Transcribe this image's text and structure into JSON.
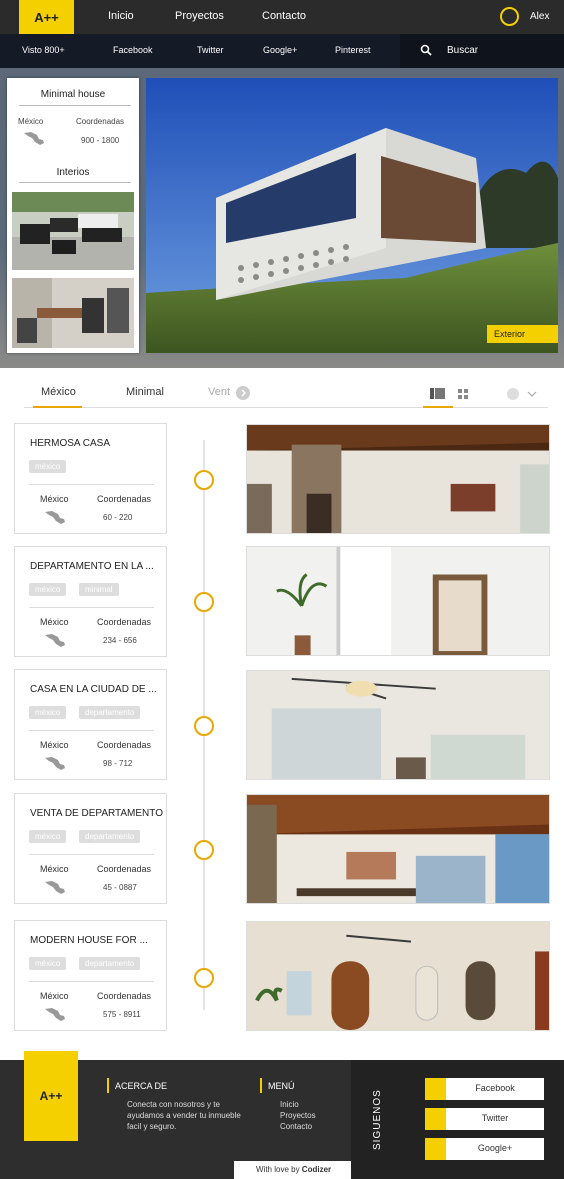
{
  "nav": {
    "logo": "A++",
    "links": [
      "Inicio",
      "Proyectos",
      "Contacto"
    ],
    "user": "Alex"
  },
  "subbar": {
    "links": [
      "Visto 800+",
      "Facebook",
      "Twitter",
      "Google+",
      "Pinterest"
    ],
    "search": "Buscar"
  },
  "info_card": {
    "title": "Minimal house",
    "country": "México",
    "coord_label": "Coordenadas",
    "coords": "900 - 1800",
    "interior_label": "Interios"
  },
  "hero": {
    "badge": "Exterior"
  },
  "tabs": [
    "México",
    "Minimal",
    "Vent"
  ],
  "listings": [
    {
      "title": "HERMOSA CASA",
      "tags": [
        "méxico"
      ],
      "country": "México",
      "coord_label": "Coordenadas",
      "coords": "60 - 220"
    },
    {
      "title": "DEPARTAMENTO EN LA ...",
      "tags": [
        "méxico",
        "minimal"
      ],
      "country": "México",
      "coord_label": "Coordenadas",
      "coords": "234 - 656"
    },
    {
      "title": "CASA EN LA CIUDAD DE ...",
      "tags": [
        "méxico",
        "departamento"
      ],
      "country": "México",
      "coord_label": "Coordenadas",
      "coords": "98 - 712"
    },
    {
      "title": "VENTA DE DEPARTAMENTO",
      "tags": [
        "méxico",
        "departamento"
      ],
      "country": "México",
      "coord_label": "Coordenadas",
      "coords": "45 - 0887"
    },
    {
      "title": "MODERN HOUSE FOR ...",
      "tags": [
        "méxico",
        "departamento"
      ],
      "country": "México",
      "coord_label": "Coordenadas",
      "coords": "575 - 8911"
    }
  ],
  "footer": {
    "logo": "A++",
    "about_title": "ACERCA DE",
    "about_text": [
      "Conecta con nosotros y te",
      "ayudamos a vender tu inmueble",
      "facil y seguro."
    ],
    "menu_title": "MENÚ",
    "menu": [
      "Inicio",
      "Proyectos",
      "Contacto"
    ],
    "follow": "SIGUENOS",
    "social": [
      "Facebook",
      "Twitter",
      "Google+"
    ],
    "credit_prefix": "With love by ",
    "credit_brand": "Codizer"
  },
  "colors": {
    "accent": "#f5d000",
    "timeline": "#e9a800",
    "dark": "#2b2b2b"
  }
}
